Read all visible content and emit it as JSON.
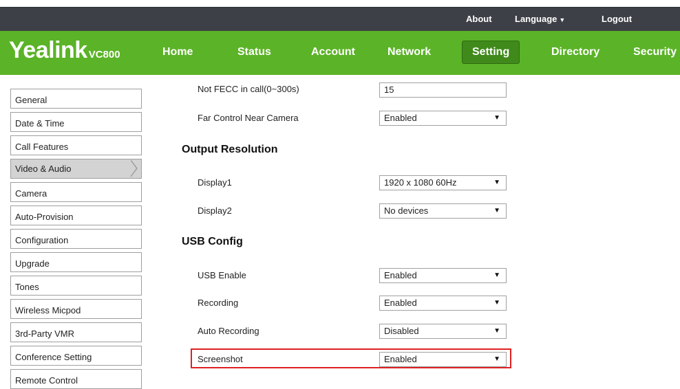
{
  "topbar": {
    "about": "About",
    "language": "Language",
    "logout": "Logout"
  },
  "logo": {
    "brand": "Yealink",
    "model": "VC800"
  },
  "nav": [
    "Home",
    "Status",
    "Account",
    "Network",
    "Setting",
    "Directory",
    "Security"
  ],
  "nav_active": "Setting",
  "sidebar": [
    "General",
    "Date & Time",
    "Call Features",
    "Video & Audio",
    "Camera",
    "Auto-Provision",
    "Configuration",
    "Upgrade",
    "Tones",
    "Wireless Micpod",
    "3rd-Party VMR",
    "Conference Setting",
    "Remote Control"
  ],
  "sidebar_active": "Video & Audio",
  "content": {
    "not_fecc": {
      "label": "Not FECC in call(0~300s)",
      "value": "15"
    },
    "far_control": {
      "label": "Far Control Near Camera",
      "value": "Enabled"
    },
    "output_resolution_title": "Output Resolution",
    "display1": {
      "label": "Display1",
      "value": "1920 x 1080 60Hz"
    },
    "display2": {
      "label": "Display2",
      "value": "No devices"
    },
    "usb_config_title": "USB Config",
    "usb_enable": {
      "label": "USB Enable",
      "value": "Enabled"
    },
    "recording": {
      "label": "Recording",
      "value": "Enabled"
    },
    "auto_recording": {
      "label": "Auto Recording",
      "value": "Disabled"
    },
    "screenshot": {
      "label": "Screenshot",
      "value": "Enabled"
    }
  },
  "colors": {
    "topbar": "#3d4046",
    "header_green": "#5bb327",
    "active_nav": "#3f8a1a",
    "highlight_red": "#e02020"
  }
}
